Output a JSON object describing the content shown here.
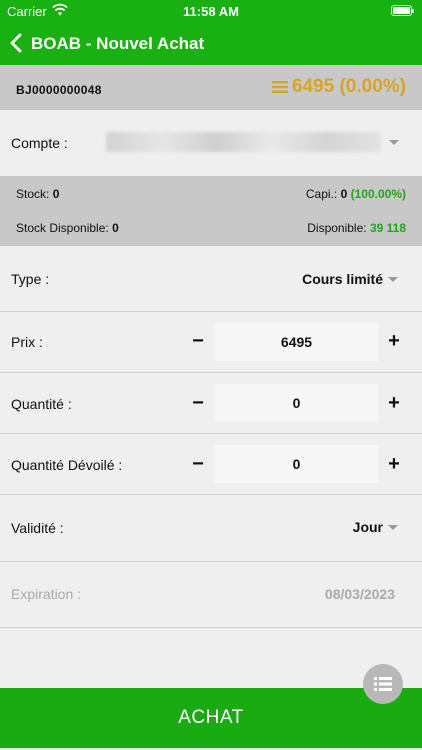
{
  "status_bar": {
    "carrier": "Carrier",
    "time": "11:58 AM"
  },
  "header": {
    "title": "BOAB - Nouvel Achat"
  },
  "instrument": {
    "code": "BJ0000000048",
    "price": "6495",
    "change": "(0.00%)"
  },
  "compte": {
    "label": "Compte :"
  },
  "stock": {
    "stock_label": "Stock:",
    "stock_value": "0",
    "capi_label": "Capi.:",
    "capi_value": "0",
    "capi_pct": "(100.00%)",
    "dispo_stock_label": "Stock Disponible:",
    "dispo_stock_value": "0",
    "dispo_label": "Disponible:",
    "dispo_value": "39 118"
  },
  "type": {
    "label": "Type :",
    "value": "Cours limité"
  },
  "prix": {
    "label": "Prix :",
    "value": "6495",
    "minus": "−",
    "plus": "+"
  },
  "quantite": {
    "label": "Quantité :",
    "value": "0",
    "minus": "−",
    "plus": "+"
  },
  "quantite_devoilee": {
    "label": "Quantité Dévoilé :",
    "value": "0",
    "minus": "−",
    "plus": "+"
  },
  "validite": {
    "label": "Validité :",
    "value": "Jour"
  },
  "expiration": {
    "label": "Expiration :",
    "value": "08/03/2023"
  },
  "action": {
    "label": "ACHAT"
  },
  "colors": {
    "brand_green": "#19b012",
    "price_gold": "#d8a425",
    "gray_band": "#c8c8c8"
  }
}
